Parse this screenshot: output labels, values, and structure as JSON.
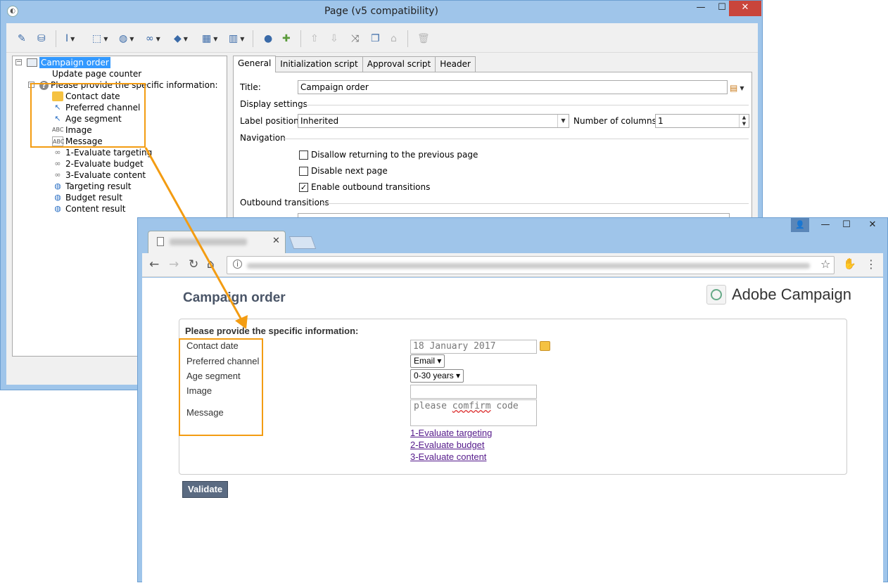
{
  "editor": {
    "title": "Page (v5 compatibility)",
    "app_icon": "adobe-campaign-icon",
    "controls": {
      "minimize": "—",
      "maximize": "☐",
      "close": "✕"
    },
    "toolbar_icons": [
      "wand-icon",
      "database-icon",
      "text-cursor-icon",
      "cursor-add-icon",
      "globe-icon",
      "link-icon",
      "cube-icon",
      "table-icon",
      "columns-icon",
      "user-icon",
      "add-icon",
      "arrow-up-icon",
      "arrow-down-icon",
      "shuffle-icon",
      "copy-icon",
      "lock-icon",
      "trash-icon"
    ],
    "tree": {
      "root": "Campaign order",
      "items": [
        "Update page counter",
        "Please provide the specific information:",
        "Contact date",
        "Preferred channel",
        "Age segment",
        "Image",
        "Message",
        "1-Evaluate targeting",
        "2-Evaluate budget",
        "3-Evaluate content",
        "Targeting result",
        "Budget result",
        "Content result"
      ]
    },
    "tabs": [
      "General",
      "Initialization script",
      "Approval script",
      "Header"
    ],
    "general": {
      "title_label": "Title:",
      "title_value": "Campaign order",
      "display_settings": "Display settings",
      "label_position_label": "Label position:",
      "label_position_value": "Inherited",
      "num_columns_label": "Number of columns:",
      "num_columns_value": "1",
      "navigation": "Navigation",
      "chk_disallow": "Disallow returning to the previous page",
      "chk_disable_next": "Disable next page",
      "chk_enable_outbound": "Enable outbound transitions",
      "outbound_transitions": "Outbound transitions"
    }
  },
  "browser": {
    "controls": {
      "user": "👤",
      "minimize": "—",
      "maximize": "☐",
      "close": "✕"
    },
    "nav": {
      "back": "←",
      "forward": "→",
      "reload": "↻",
      "home": "⌂",
      "star": "☆",
      "menu": "⋮"
    },
    "page": {
      "title": "Campaign order",
      "brand": "Adobe Campaign",
      "form_heading": "Please provide the specific information:",
      "labels": [
        "Contact date",
        "Preferred channel",
        "Age segment",
        "Image",
        "Message"
      ],
      "contact_date": "18 January 2017",
      "preferred_channel": "Email ▾",
      "age_segment": "0-30 years ▾",
      "message_prefix": "please ",
      "message_misspelled": "comfirm",
      "message_suffix": " code",
      "links": [
        "1-Evaluate targeting",
        "2-Evaluate budget",
        "3-Evaluate content"
      ],
      "validate": "Validate"
    }
  },
  "colors": {
    "highlight": "#f39c12",
    "window_frame": "#9fc5ea",
    "close_button": "#c9453b",
    "selection": "#3399ff",
    "link": "#551a8b",
    "validate_button": "#5b6b82"
  }
}
